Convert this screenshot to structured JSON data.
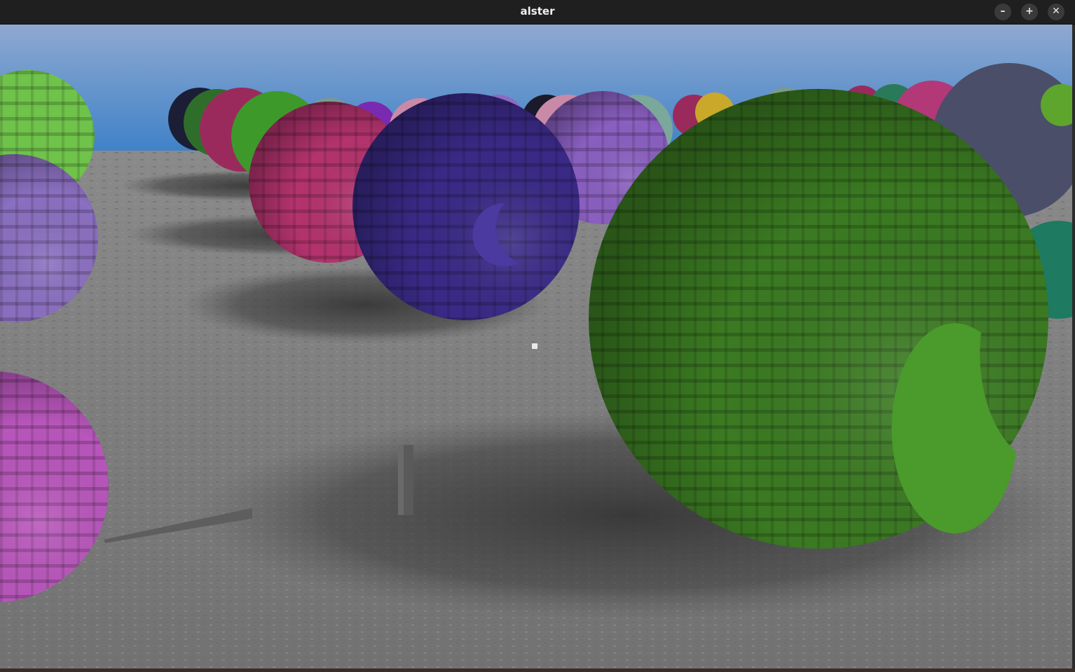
{
  "window": {
    "title": "alster",
    "minimize_icon": "minimize-icon",
    "maximize_icon": "maximize-icon",
    "close_icon": "close-icon",
    "minimize_glyph": "–",
    "maximize_glyph": "+",
    "close_glyph": "✕"
  },
  "scene": {
    "sky_top": "#8aa6cf",
    "sky_bottom": "#3f82c9",
    "ground": "#7d7d7d",
    "sphere_colors": [
      "#3a2a86",
      "#3a7420",
      "#b33878",
      "#b95abb",
      "#8a6bc2",
      "#5ea52d",
      "#9b2a5c"
    ]
  }
}
